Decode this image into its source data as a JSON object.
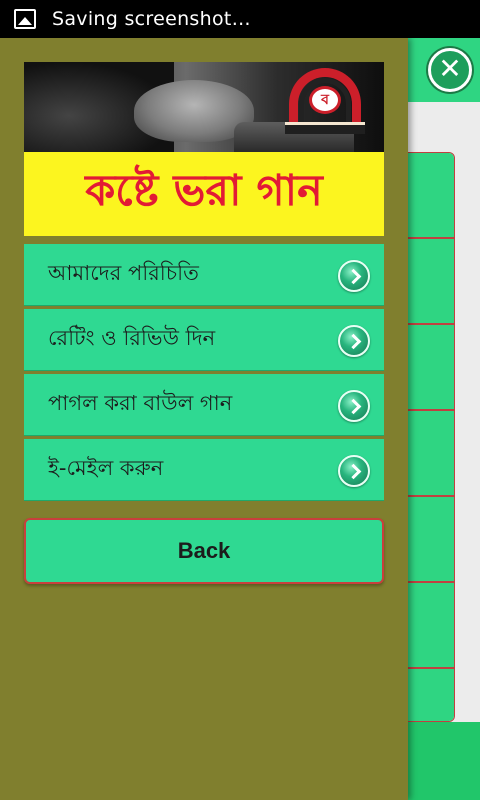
{
  "status_bar": {
    "icon": "image-icon",
    "text": "Saving screenshot…"
  },
  "background": {
    "close_icon": "close-icon",
    "accent": "#2fd582"
  },
  "drawer": {
    "banner": {
      "logo_glyph": "ব",
      "title": "কষ্টে ভরা গান"
    },
    "menu": [
      {
        "label": "আমাদের পরিচিতি",
        "icon": "chevron-right-icon"
      },
      {
        "label": "রেটিং ও রিভিউ দিন",
        "icon": "chevron-right-icon"
      },
      {
        "label": "পাগল করা বাউল গান",
        "icon": "chevron-right-icon"
      },
      {
        "label": "ই-মেইল করুন",
        "icon": "chevron-right-icon"
      }
    ],
    "back_label": "Back",
    "colors": {
      "drawer_bg": "#807f2e",
      "item_bg": "#2fd992",
      "title_bg": "#fcf51f",
      "title_text": "#e21a35"
    }
  }
}
